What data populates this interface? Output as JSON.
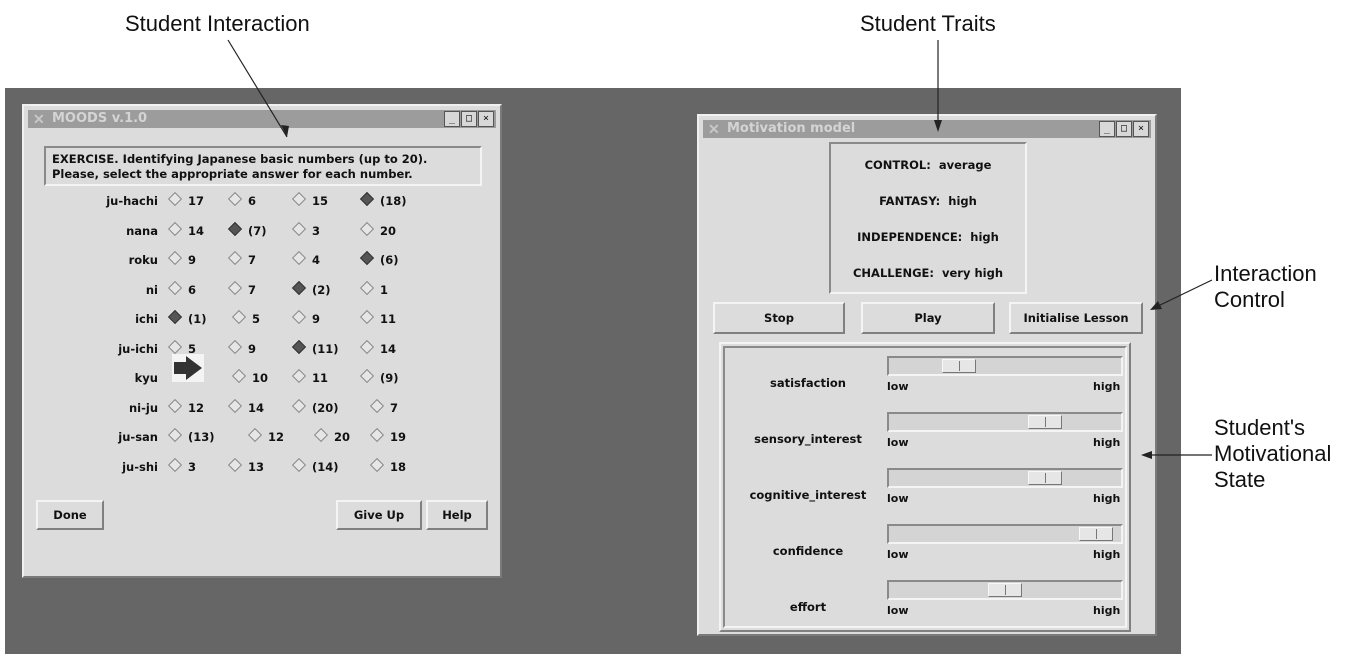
{
  "annotations": {
    "student_interaction": "Student Interaction",
    "student_traits": "Student Traits",
    "interaction_control_1": "Interaction",
    "interaction_control_2": "Control",
    "motivational_state_1": "Student's",
    "motivational_state_2": "Motivational",
    "motivational_state_3": "State"
  },
  "left_window": {
    "title": "MOODS v.1.0",
    "exercise_line1": "EXERCISE. Identifying Japanese basic numbers (up to 20).",
    "exercise_line2": "Please, select the appropriate answer for each number.",
    "questions": [
      {
        "label": "ju-hachi",
        "options": [
          "17",
          "6",
          "15",
          "(18)"
        ],
        "selected": 3
      },
      {
        "label": "nana",
        "options": [
          "14",
          "(7)",
          "3",
          "20"
        ],
        "selected": 1
      },
      {
        "label": "roku",
        "options": [
          "9",
          "7",
          "4",
          "(6)"
        ],
        "selected": 3
      },
      {
        "label": "ni",
        "options": [
          "6",
          "7",
          "(2)",
          "1"
        ],
        "selected": 2
      },
      {
        "label": "ichi",
        "options": [
          "(1)",
          "5",
          "9",
          "11"
        ],
        "selected": 0
      },
      {
        "label": "ju-ichi",
        "options": [
          "5",
          "9",
          "(11)",
          "14"
        ],
        "selected": 2
      },
      {
        "label": "kyu",
        "options": [
          "",
          "10",
          "11",
          "(9)"
        ],
        "selected": -1
      },
      {
        "label": "ni-ju",
        "options": [
          "12",
          "14",
          "(20)",
          "7"
        ],
        "selected": -1
      },
      {
        "label": "ju-san",
        "options": [
          "(13)",
          "12",
          "20",
          "19"
        ],
        "selected": -1
      },
      {
        "label": "ju-shi",
        "options": [
          "3",
          "13",
          "(14)",
          "18"
        ],
        "selected": -1
      }
    ],
    "buttons": {
      "done": "Done",
      "give_up": "Give Up",
      "help": "Help"
    }
  },
  "right_window": {
    "title": "Motivation model",
    "traits": [
      {
        "name": "CONTROL:",
        "value": "average"
      },
      {
        "name": "FANTASY:",
        "value": "high"
      },
      {
        "name": "INDEPENDENCE:",
        "value": "high"
      },
      {
        "name": "CHALLENGE:",
        "value": "very high"
      }
    ],
    "buttons": {
      "stop": "Stop",
      "play": "Play",
      "initialise": "Initialise Lesson"
    },
    "sliders": [
      {
        "label": "satisfaction",
        "level": 0.27
      },
      {
        "label": "sensory_interest",
        "level": 0.7
      },
      {
        "label": "cognitive_interest",
        "level": 0.7
      },
      {
        "label": "confidence",
        "level": 0.96
      },
      {
        "label": "effort",
        "level": 0.5
      }
    ],
    "low_label": "low",
    "high_label": "high"
  },
  "window_buttons": {
    "minimize": "_",
    "maximize": "□",
    "close": "×"
  }
}
